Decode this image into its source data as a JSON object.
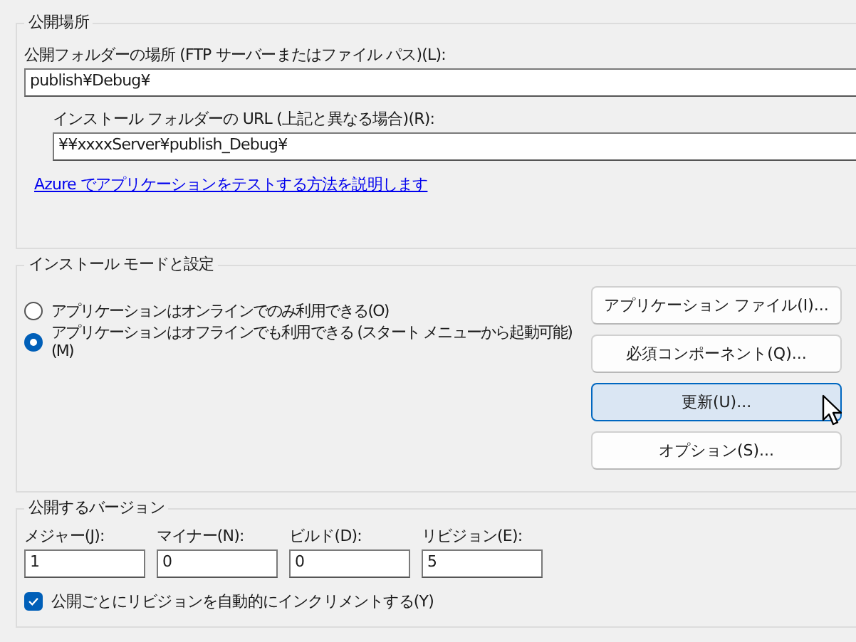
{
  "publish_location": {
    "title": "公開場所",
    "folder_label": "公開フォルダーの場所 (FTP サーバーまたはファイル パス)(L):",
    "folder_value": "publish¥Debug¥",
    "install_url_label": "インストール フォルダーの URL (上記と異なる場合)(R):",
    "install_url_value": "¥¥xxxxServer¥publish_Debug¥",
    "help_link": "Azure でアプリケーションをテストする方法を説明します"
  },
  "install_mode": {
    "title": "インストール モードと設定",
    "options": [
      {
        "label": "アプリケーションはオンラインでのみ利用できる(O)",
        "selected": false
      },
      {
        "label": "アプリケーションはオフラインでも利用できる (スタート メニューから起動可能)(M)",
        "selected": true
      }
    ],
    "buttons": [
      {
        "label": "アプリケーション ファイル(I)...",
        "hovered": false
      },
      {
        "label": "必須コンポーネント(Q)...",
        "hovered": false
      },
      {
        "label": "更新(U)...",
        "hovered": true
      },
      {
        "label": "オプション(S)...",
        "hovered": false
      }
    ]
  },
  "publish_version": {
    "title": "公開するバージョン",
    "fields": [
      {
        "label": "メジャー(J):",
        "value": "1"
      },
      {
        "label": "マイナー(N):",
        "value": "0"
      },
      {
        "label": "ビルド(D):",
        "value": "0"
      },
      {
        "label": "リビジョン(E):",
        "value": "5"
      }
    ],
    "auto_increment": {
      "label": "公開ごとにリビジョンを自動的にインクリメントする(Y)",
      "checked": true
    }
  }
}
